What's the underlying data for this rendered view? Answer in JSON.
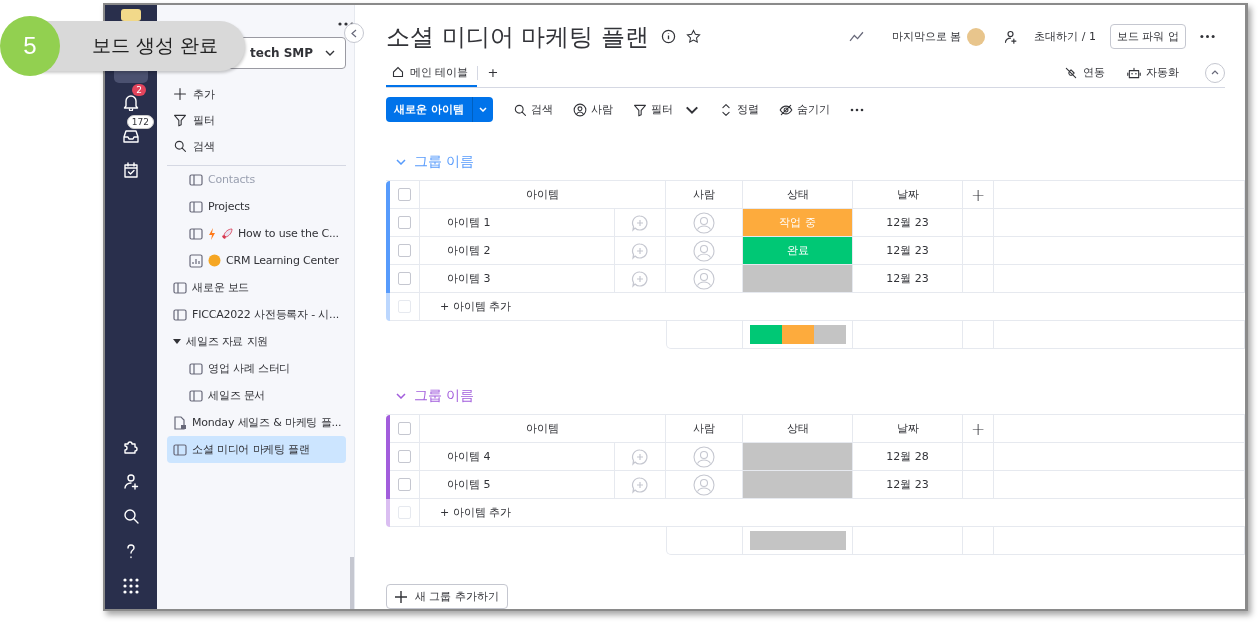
{
  "overlay": {
    "step": "5",
    "label": "보드 생성 완료"
  },
  "rail": {
    "notifications_badge": "2",
    "inbox_badge": "172"
  },
  "sidebar": {
    "workspace": "tech SMP",
    "actions": [
      {
        "kind": "add",
        "label": "추가"
      },
      {
        "kind": "filter",
        "label": "필터"
      },
      {
        "kind": "search",
        "label": "검색"
      }
    ],
    "items": [
      {
        "children": [
          {
            "kind": "board",
            "label": "Contacts",
            "faded": true,
            "selected": false
          },
          {
            "kind": "board",
            "label": "Projects",
            "faded": false,
            "selected": false
          },
          {
            "kind": "board-launch",
            "label": "How to use the C...",
            "faded": false,
            "selected": false
          },
          {
            "kind": "dashboard-emoji",
            "label": "CRM Learning Center",
            "faded": false,
            "selected": false
          }
        ]
      },
      {
        "kind": "board",
        "label": "새로운 보드",
        "selected": false
      },
      {
        "kind": "board",
        "label": "FICCA2022 사전등록자 - 시...",
        "selected": false
      },
      {
        "kind": "folder",
        "label": "세일즈 자료 지원",
        "expanded": true,
        "selected": false,
        "children": [
          {
            "kind": "board",
            "label": "영업 사례 스터디",
            "selected": false
          },
          {
            "kind": "board",
            "label": "세일즈 문서",
            "selected": false
          }
        ]
      },
      {
        "kind": "doc",
        "label": "Monday 세일즈 & 마케팅 플...",
        "selected": false
      },
      {
        "kind": "board",
        "label": "소셜 미디어 마케팅 플랜",
        "selected": true
      }
    ]
  },
  "header": {
    "title": "소셜 미디어 마케팅 플랜",
    "last_seen": "마지막으로 봄",
    "invite": "초대하기 / 1",
    "power_up": "보드 파워 업"
  },
  "tabs": [
    {
      "label": "메인 테이블",
      "selected": true
    }
  ],
  "add_tab": "+",
  "view_actions": [
    {
      "kind": "integrate",
      "label": "연동"
    },
    {
      "kind": "automate",
      "label": "자동화"
    }
  ],
  "toolbar": {
    "new_item": "새로운 아이템",
    "tools": [
      {
        "kind": "search",
        "label": "검색"
      },
      {
        "kind": "person",
        "label": "사람"
      },
      {
        "kind": "filter",
        "label": "필터"
      },
      {
        "kind": "sort",
        "label": "정렬"
      },
      {
        "kind": "hide",
        "label": "숨기기"
      }
    ]
  },
  "groups": [
    {
      "name": "그룹 이름",
      "color": "#579bfc",
      "all_checked": false,
      "columns": [
        "아이템",
        "사람",
        "상태",
        "날짜"
      ],
      "add_column": "+",
      "rows": [
        {
          "item": "아이템 1",
          "status": {
            "label": "작업 중",
            "color": "#fdab3d"
          },
          "date": "12월 23",
          "checked": false
        },
        {
          "item": "아이템 2",
          "status": {
            "label": "완료",
            "color": "#00c875"
          },
          "date": "12월 23",
          "checked": false
        },
        {
          "item": "아이템 3",
          "status": {
            "color": "#c4c4c4"
          },
          "date": "12월 23",
          "checked": false
        }
      ],
      "add_item": "+ 아이템 추가",
      "add_row_checked": false,
      "summary": [
        {
          "color": "#00c875"
        },
        {
          "color": "#fdab3d"
        },
        {
          "color": "#c4c4c4"
        }
      ]
    },
    {
      "name": "그룹 이름",
      "color": "#a25ddc",
      "all_checked": false,
      "columns": [
        "아이템",
        "사람",
        "상태",
        "날짜"
      ],
      "add_column": "+",
      "rows": [
        {
          "item": "아이템 4",
          "status": {
            "color": "#c4c4c4"
          },
          "date": "12월 28",
          "checked": false
        },
        {
          "item": "아이템 5",
          "status": {
            "color": "#c4c4c4"
          },
          "date": "12월 23",
          "checked": false
        }
      ],
      "add_item": "+ 아이템 추가",
      "add_row_checked": false,
      "summary": [
        {
          "color": "#c4c4c4"
        }
      ]
    }
  ],
  "add_group": "새 그룹 추가하기"
}
